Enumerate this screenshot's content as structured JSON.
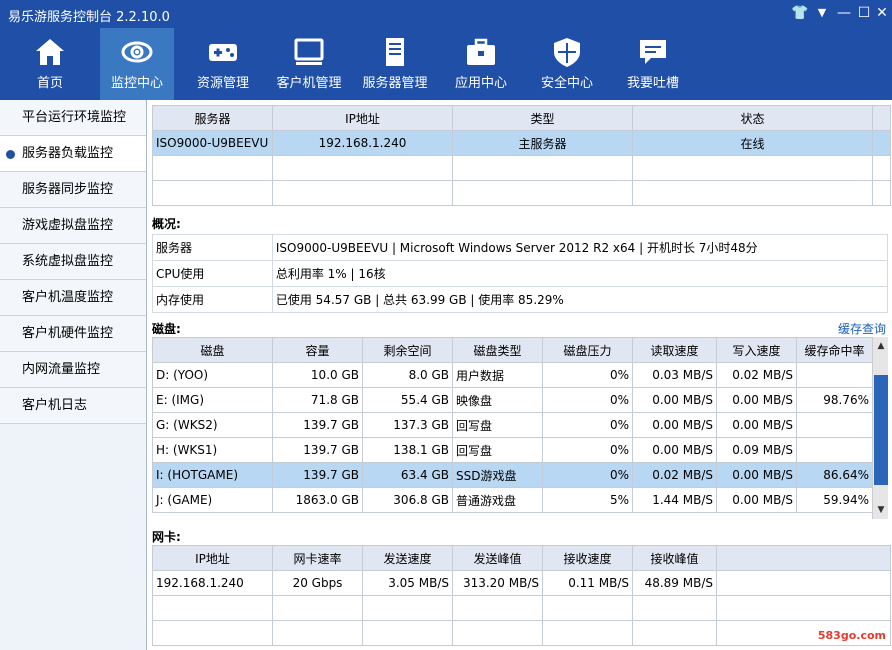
{
  "app": {
    "title": "易乐游服务控制台 2.2.10.0"
  },
  "window_controls": {
    "shirt": "👕",
    "menu": "▼",
    "minimize": "—",
    "maximize": "☐",
    "close": "✕"
  },
  "nav": [
    {
      "label": "首页",
      "icon": "home-icon"
    },
    {
      "label": "监控中心",
      "icon": "eye-icon",
      "active": true
    },
    {
      "label": "资源管理",
      "icon": "gamepad-icon"
    },
    {
      "label": "客户机管理",
      "icon": "monitor-icon"
    },
    {
      "label": "服务器管理",
      "icon": "server-icon"
    },
    {
      "label": "应用中心",
      "icon": "toolbox-icon"
    },
    {
      "label": "安全中心",
      "icon": "shield-icon"
    },
    {
      "label": "我要吐槽",
      "icon": "chat-icon"
    }
  ],
  "sidebar": [
    {
      "label": "平台运行环境监控"
    },
    {
      "label": "服务器负载监控",
      "active": true
    },
    {
      "label": "服务器同步监控"
    },
    {
      "label": "游戏虚拟盘监控"
    },
    {
      "label": "系统虚拟盘监控"
    },
    {
      "label": "客户机温度监控"
    },
    {
      "label": "客户机硬件监控"
    },
    {
      "label": "内网流量监控"
    },
    {
      "label": "客户机日志"
    }
  ],
  "servers": {
    "headers": [
      "服务器",
      "IP地址",
      "类型",
      "状态"
    ],
    "rows": [
      [
        "ISO9000-U9BEEVU",
        "192.168.1.240",
        "主服务器",
        "在线"
      ]
    ]
  },
  "overview": {
    "title": "概况:",
    "rows": [
      {
        "label": "服务器",
        "value": "ISO9000-U9BEEVU | Microsoft Windows Server 2012 R2 x64 | 开机时长 7小时48分"
      },
      {
        "label": "CPU使用",
        "value": "总利用率 1% | 16核"
      },
      {
        "label": "内存使用",
        "value": "已使用 54.57 GB | 总共 63.99 GB | 使用率 85.29%"
      }
    ]
  },
  "disks": {
    "title": "磁盘:",
    "cache_link": "缓存查询",
    "headers": [
      "磁盘",
      "容量",
      "剩余空间",
      "磁盘类型",
      "磁盘压力",
      "读取速度",
      "写入速度",
      "缓存命中率"
    ],
    "rows": [
      [
        "D: (YOO)",
        "10.0 GB",
        "8.0 GB",
        "用户数据",
        "0%",
        "0.03 MB/S",
        "0.02 MB/S",
        ""
      ],
      [
        "E: (IMG)",
        "71.8 GB",
        "55.4 GB",
        "映像盘",
        "0%",
        "0.00 MB/S",
        "0.00 MB/S",
        "98.76%"
      ],
      [
        "G: (WKS2)",
        "139.7 GB",
        "137.3 GB",
        "回写盘",
        "0%",
        "0.00 MB/S",
        "0.00 MB/S",
        ""
      ],
      [
        "H: (WKS1)",
        "139.7 GB",
        "138.1 GB",
        "回写盘",
        "0%",
        "0.00 MB/S",
        "0.09 MB/S",
        ""
      ],
      [
        "I: (HOTGAME)",
        "139.7 GB",
        "63.4 GB",
        "SSD游戏盘",
        "0%",
        "0.02 MB/S",
        "0.00 MB/S",
        "86.64%"
      ],
      [
        "J: (GAME)",
        "1863.0 GB",
        "306.8 GB",
        "普通游戏盘",
        "5%",
        "1.44 MB/S",
        "0.00 MB/S",
        "59.94%"
      ]
    ],
    "selected_row": 4
  },
  "nics": {
    "title": "网卡:",
    "headers": [
      "IP地址",
      "网卡速率",
      "发送速度",
      "发送峰值",
      "接收速度",
      "接收峰值"
    ],
    "rows": [
      [
        "192.168.1.240",
        "20 Gbps",
        "3.05 MB/S",
        "313.20 MB/S",
        "0.11 MB/S",
        "48.89 MB/S"
      ]
    ]
  },
  "watermark": "583go.com",
  "colors": {
    "accent": "#1f4fa6",
    "nav_active": "#3a78c2",
    "selection": "#b8d7f3",
    "header_bg": "#e1e6f3"
  }
}
